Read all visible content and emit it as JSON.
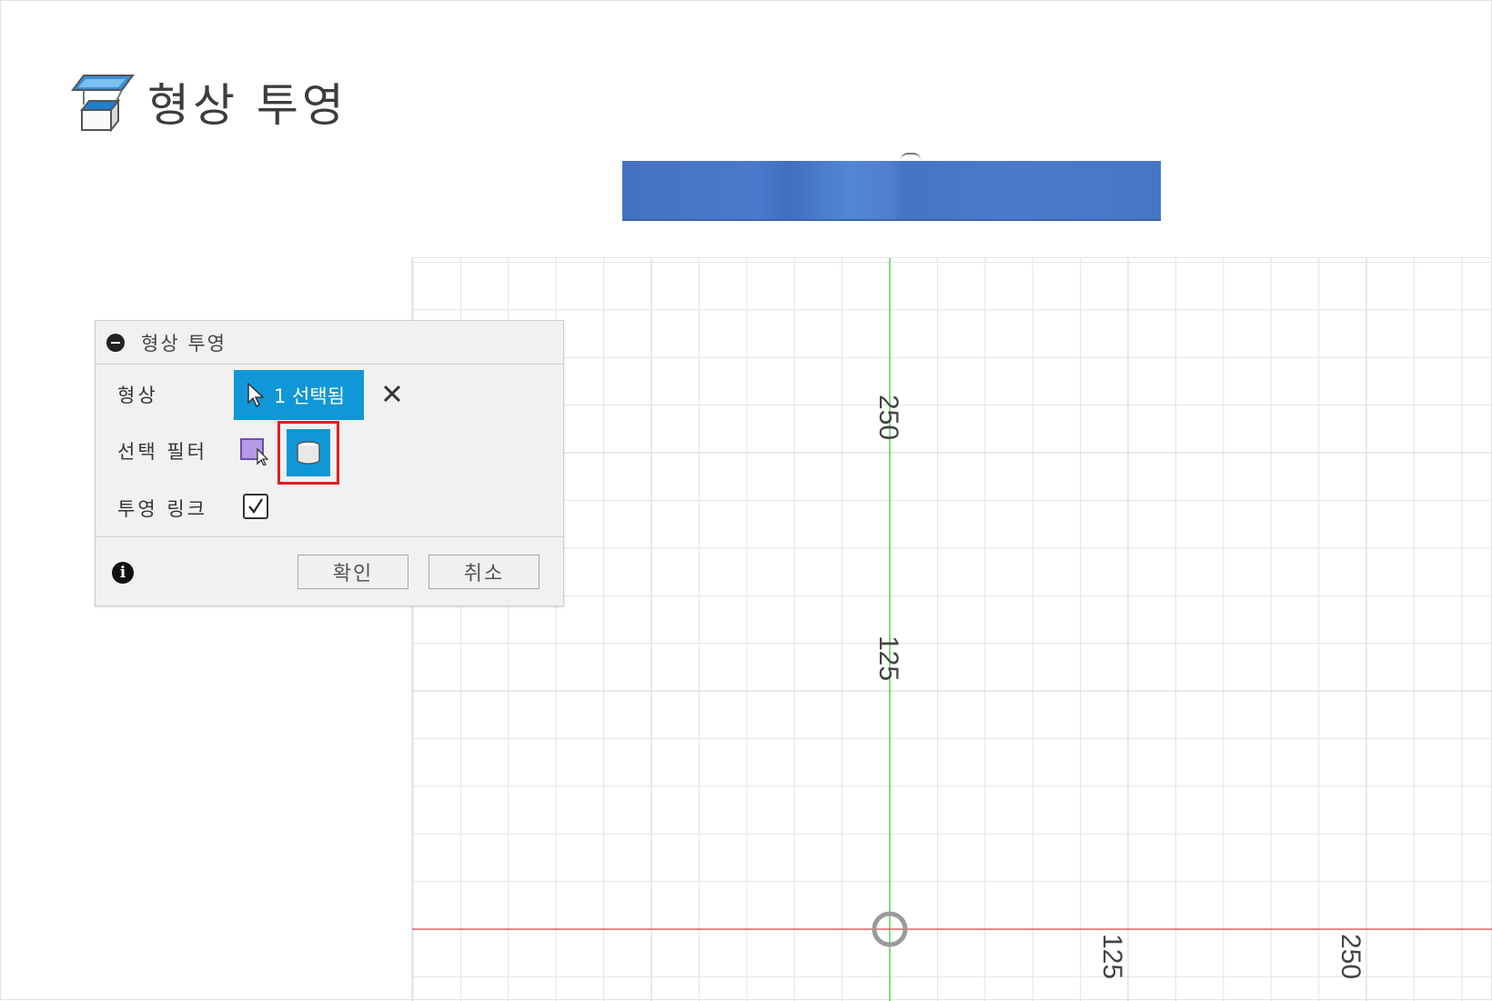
{
  "page": {
    "title": "형상 투영",
    "title_icon": "project-geometry-icon"
  },
  "dialog": {
    "header_title": "형상 투영",
    "geometry_label": "형상",
    "selection_value": "1 선택됨",
    "filter_label": "선택 필터",
    "filter_options": [
      "face-filter-icon",
      "body-filter-icon"
    ],
    "projection_link_label": "투영 링크",
    "projection_link_checked": true,
    "ok_label": "확인",
    "cancel_label": "취소"
  },
  "viewport": {
    "axis_labels_vertical": [
      "250",
      "125"
    ],
    "axis_labels_horizontal": [
      "125",
      "250"
    ],
    "colors": {
      "grid": "#e4e4e4",
      "y_axis": "#57d157",
      "x_axis": "#e06060",
      "body": "#4a7acb",
      "accent": "#0f97d8",
      "highlight": "#e31b23"
    }
  }
}
